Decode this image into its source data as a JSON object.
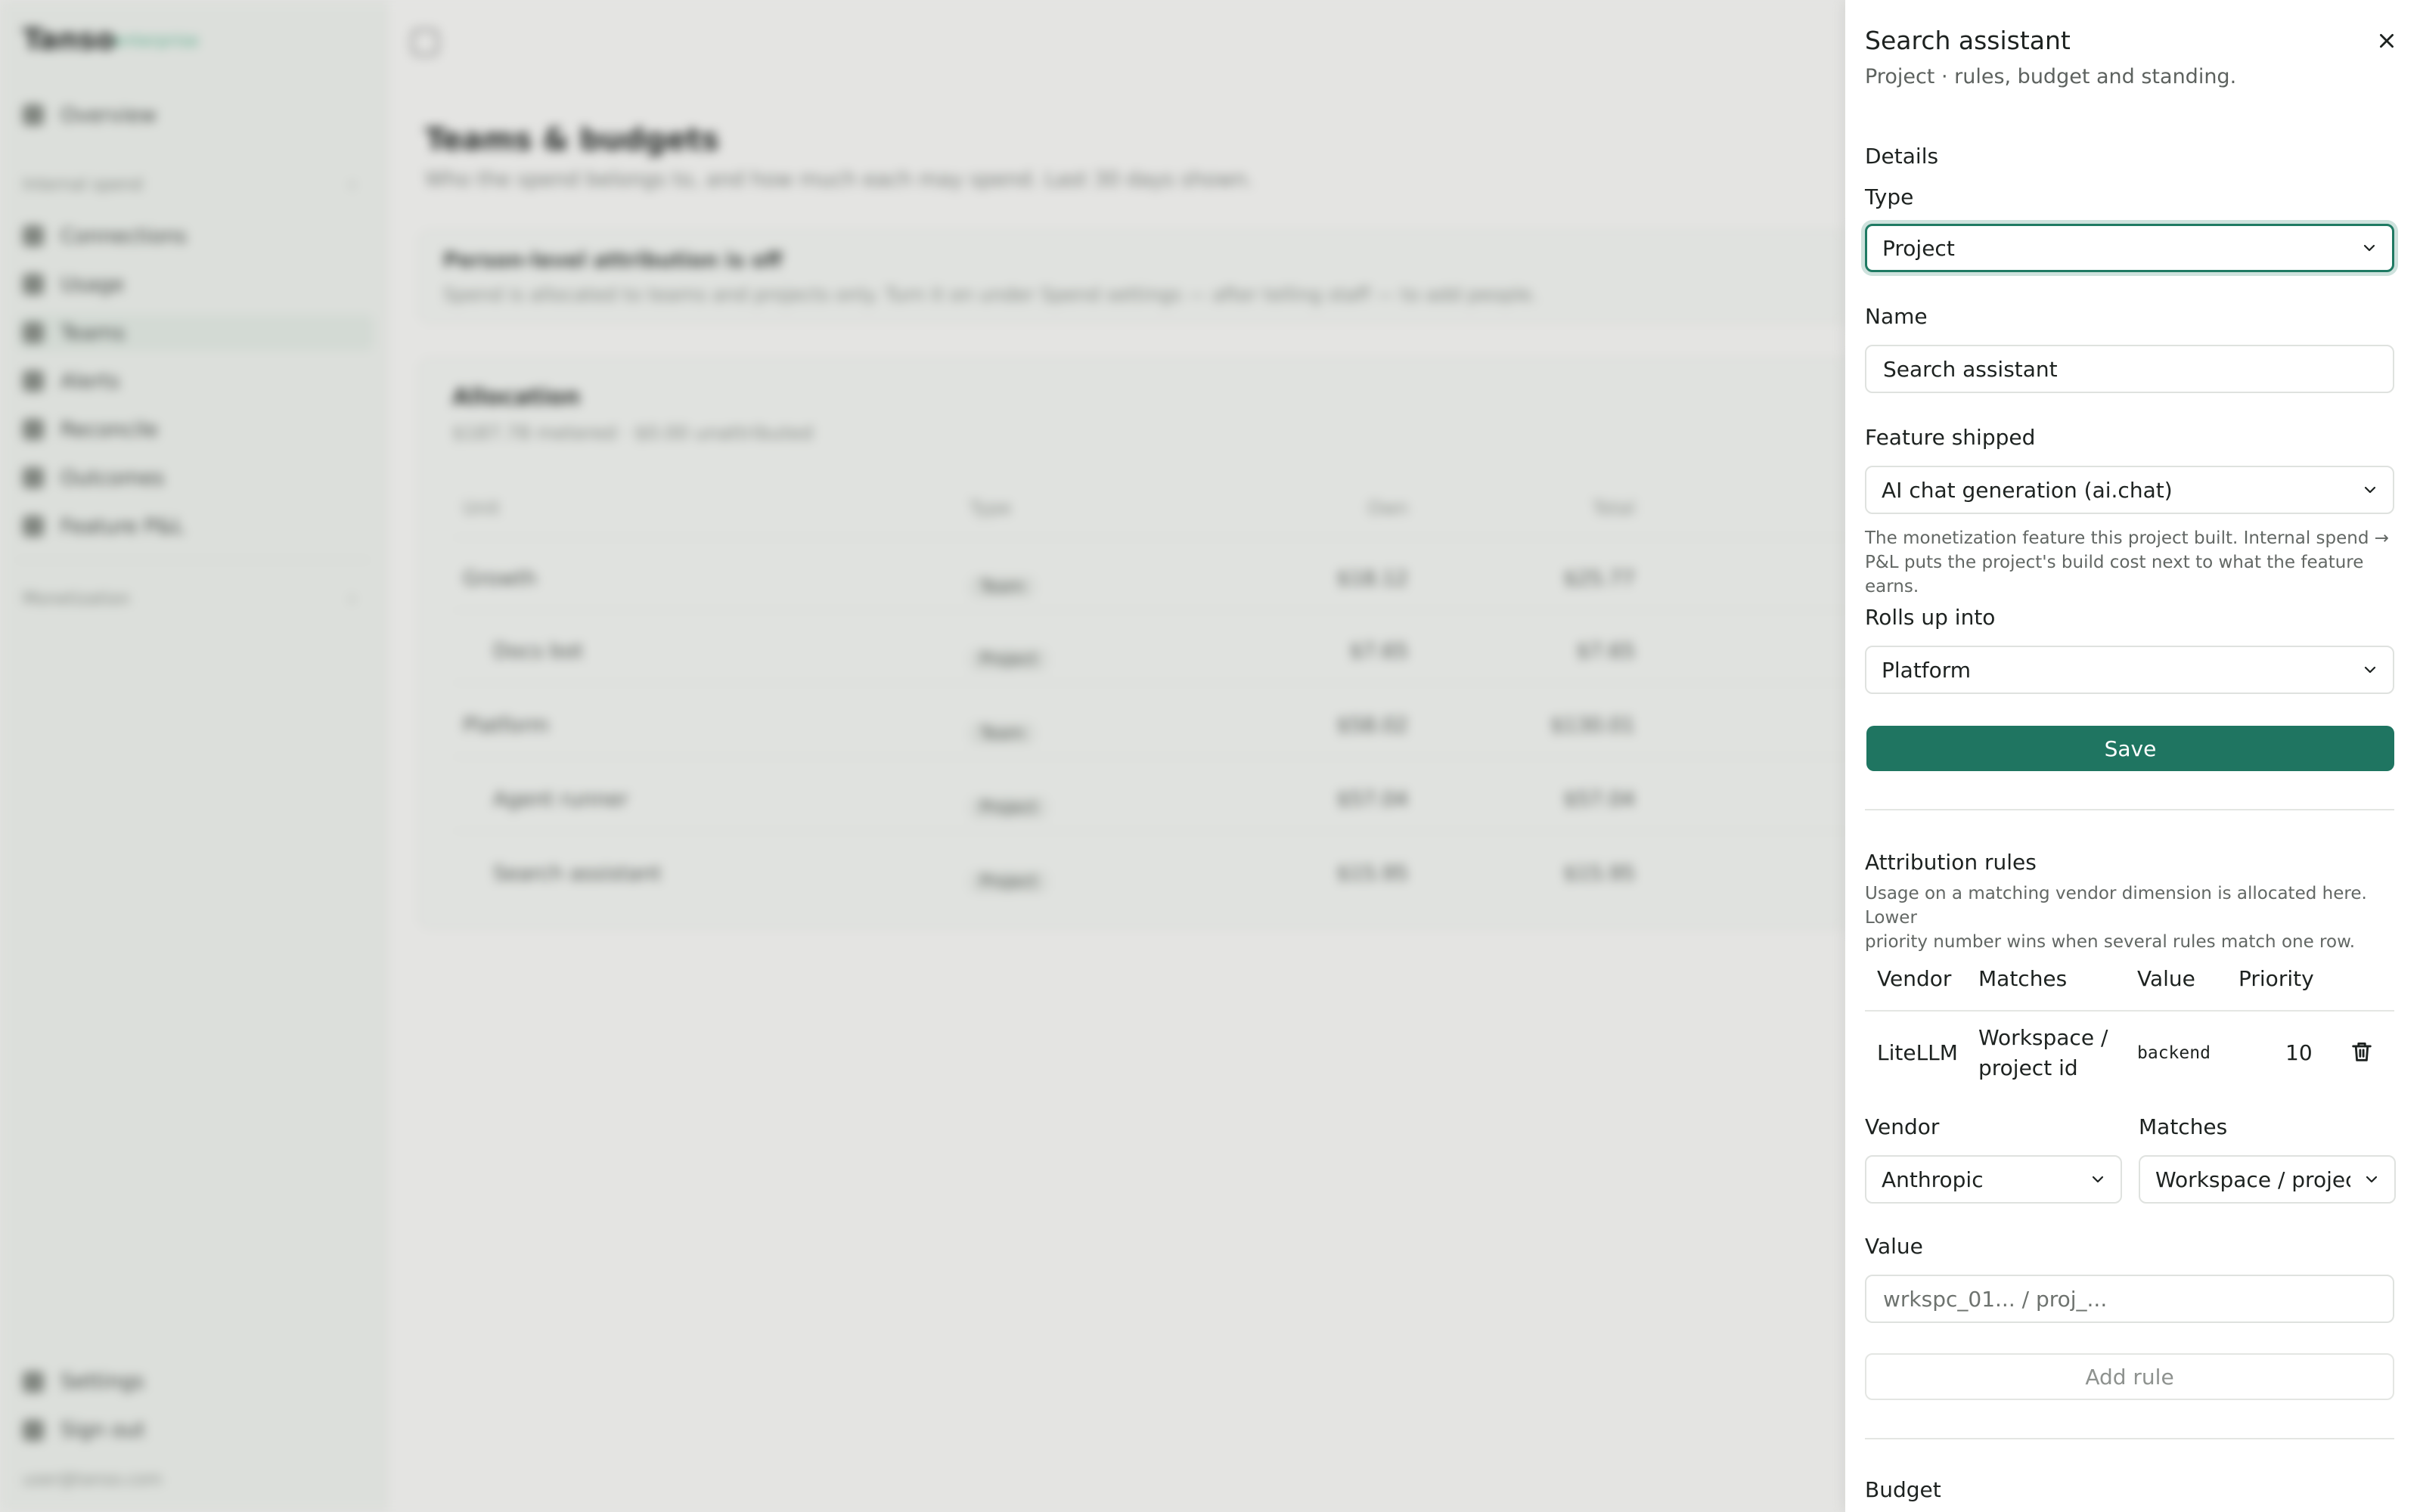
{
  "background": {
    "brand": "Tanso",
    "brand_tag": "enterprise",
    "nav": {
      "overview": "Overview",
      "group_internal": "Internal spend",
      "connections": "Connections",
      "usage": "Usage",
      "teams": "Teams",
      "alerts": "Alerts",
      "reconcile": "Reconcile",
      "outcomes": "Outcomes",
      "feature_pnl": "Feature P&L",
      "group_monetization": "Monetization",
      "settings": "Settings",
      "sign_out": "Sign out",
      "email": "user@tanso.com"
    },
    "page_title": "Teams & budgets",
    "page_subtitle": "Who the spend belongs to, and how much each may spend. Last 30 days shown.",
    "notice": {
      "title": "Person-level attribution is off",
      "body": "Spend is allocated to teams and projects only. Turn it on under Spend settings — after telling staff — to add people."
    },
    "allocation": {
      "title": "Allocation",
      "subtitle": "$187.78 metered · $0.00 unattributed",
      "columns": [
        "Unit",
        "Type",
        "Own",
        "Total"
      ],
      "rows": [
        {
          "unit": "Growth",
          "type": "Team",
          "own": "$18.12",
          "total": "$25.77",
          "indent": false
        },
        {
          "unit": "Docs bot",
          "type": "Project",
          "own": "$7.65",
          "total": "$7.65",
          "indent": true
        },
        {
          "unit": "Platform",
          "type": "Team",
          "own": "$58.02",
          "total": "$130.01",
          "indent": false
        },
        {
          "unit": "Agent runner",
          "type": "Project",
          "own": "$57.04",
          "total": "$57.04",
          "indent": true
        },
        {
          "unit": "Search assistant",
          "type": "Project",
          "own": "$15.95",
          "total": "$15.95",
          "indent": true
        }
      ]
    }
  },
  "panel": {
    "title": "Search assistant",
    "subtitle": "Project · rules, budget and standing.",
    "details_heading": "Details",
    "type_label": "Type",
    "type_value": "Project",
    "name_label": "Name",
    "name_value": "Search assistant",
    "feature_label": "Feature shipped",
    "feature_value": "AI chat generation (ai.chat)",
    "feature_hint_1": "The monetization feature this project built. Internal spend →",
    "feature_hint_2": "P&L puts the project's build cost next to what the feature earns.",
    "rollup_label": "Rolls up into",
    "rollup_value": "Platform",
    "save_label": "Save",
    "rules_heading": "Attribution rules",
    "rules_hint_1": "Usage on a matching vendor dimension is allocated here. Lower",
    "rules_hint_2": "priority number wins when several rules match one row.",
    "rules_columns": {
      "vendor": "Vendor",
      "matches": "Matches",
      "value": "Value",
      "priority": "Priority"
    },
    "rules": [
      {
        "vendor": "LiteLLM",
        "matches_1": "Workspace /",
        "matches_2": "project id",
        "value": "backend",
        "priority": "10"
      }
    ],
    "new_rule": {
      "vendor_label": "Vendor",
      "vendor_value": "Anthropic",
      "matches_label": "Matches",
      "matches_value": "Workspace / project",
      "value_label": "Value",
      "value_placeholder": "wrkspc_01... / proj_...",
      "add_label": "Add rule"
    },
    "budget_heading": "Budget"
  }
}
